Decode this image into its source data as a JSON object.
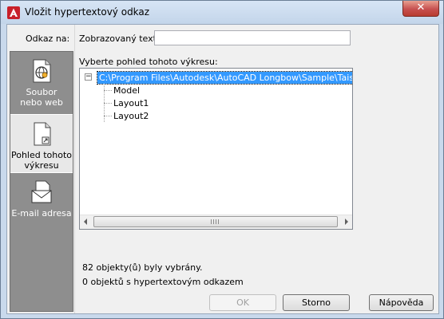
{
  "window": {
    "title": "Vložit hypertextový odkaz",
    "close_glyph": "✕",
    "app_icon": "autocad-a-icon",
    "accent_color": "#3399ff"
  },
  "sidebar": {
    "header": "Odkaz na:",
    "items": [
      {
        "label_line1": "Soubor",
        "label_line2": "nebo web",
        "icon": "file-globe-icon"
      },
      {
        "label_line1": "Pohled tohoto",
        "label_line2": "výkresu",
        "icon": "drawing-view-icon",
        "selected": true
      },
      {
        "label_line1": "E-mail adresa",
        "label_line2": "",
        "icon": "email-icon"
      }
    ]
  },
  "display_text": {
    "label": "Zobrazovaný text:",
    "value": ""
  },
  "tree": {
    "label": "Vyberte pohled tohoto výkresu:",
    "expander": "−",
    "root": "C:\\Program Files\\Autodesk\\AutoCAD Longbow\\Sample\\Taisei Detail",
    "children": [
      "Model",
      "Layout1",
      "Layout2"
    ]
  },
  "status": {
    "selected_count": "82 objekty(ů) byly vybrány.",
    "hyperlink_count": "0 objektů s hypertextovým odkazem"
  },
  "buttons": {
    "ok": "OK",
    "cancel": "Storno",
    "help": "Nápověda"
  }
}
